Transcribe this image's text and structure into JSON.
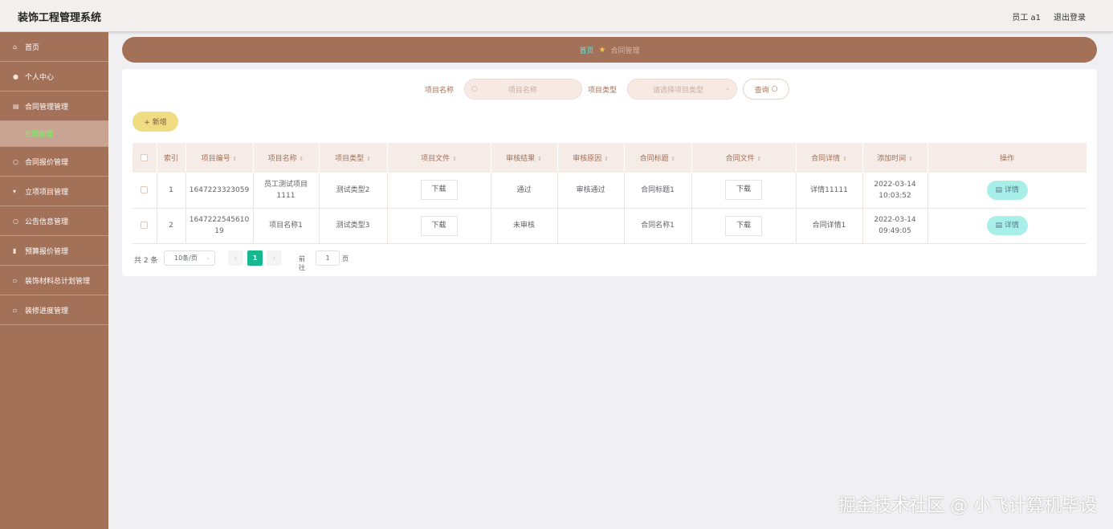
{
  "app": {
    "title": "装饰工程管理系统"
  },
  "header": {
    "user": "员工 a1",
    "logout": "退出登录"
  },
  "sidebar": {
    "items": [
      {
        "label": "首页",
        "icon": "home-icon"
      },
      {
        "label": "个人中心",
        "icon": "user-icon"
      },
      {
        "label": "合同管理管理",
        "icon": "contract-icon"
      },
      {
        "label": "合同管理",
        "icon": ""
      },
      {
        "label": "合同报价管理",
        "icon": "quote-icon"
      },
      {
        "label": "立项项目管理",
        "icon": "project-icon"
      },
      {
        "label": "公告信息管理",
        "icon": "notice-icon"
      },
      {
        "label": "预算报价管理",
        "icon": "budget-icon"
      },
      {
        "label": "装饰材料总计划管理",
        "icon": "material-icon"
      },
      {
        "label": "装修进度管理",
        "icon": "progress-icon"
      }
    ]
  },
  "breadcrumb": {
    "home": "首页",
    "sep": "★",
    "current": "合同管理"
  },
  "search": {
    "name_label": "项目名称",
    "name_placeholder": "项目名称",
    "type_label": "项目类型",
    "type_placeholder": "请选择项目类型",
    "button": "查询"
  },
  "toolbar": {
    "add": "+ 新增"
  },
  "table": {
    "columns": [
      "索引",
      "项目编号",
      "项目名称",
      "项目类型",
      "项目文件",
      "审核结果",
      "审核原因",
      "合同标题",
      "合同文件",
      "合同详情",
      "添加时间",
      "操作"
    ],
    "sortable_marker": "⇕",
    "rows": [
      {
        "index": "1",
        "code": "1647223323059",
        "name": "员工测试项目1111",
        "type": "测试类型2",
        "file": "下载",
        "result": "通过",
        "reason": "审核通过",
        "title": "合同标题1",
        "contract_file": "下载",
        "detail": "详情11111",
        "time": "2022-03-14 10:03:52",
        "action": "详情"
      },
      {
        "index": "2",
        "code": "1647222545610 19",
        "name": "项目名称1",
        "type": "测试类型3",
        "file": "下载",
        "result": "未审核",
        "reason": "",
        "title": "合同名称1",
        "contract_file": "下载",
        "detail": "合同详情1",
        "time": "2022-03-14 09:49:05",
        "action": "详情"
      }
    ]
  },
  "pagination": {
    "total": "共 2 条",
    "page_size": "10条/页",
    "current_page": "1",
    "goto": "前往",
    "goto_value": "1",
    "page_suffix": "页"
  },
  "watermark": "掘金技术社区 @ 小飞计算机毕设",
  "colors": {
    "sidebar": "#a37058",
    "accent": "#17b890",
    "add": "#f0dc82",
    "detail": "#a8eee9"
  }
}
